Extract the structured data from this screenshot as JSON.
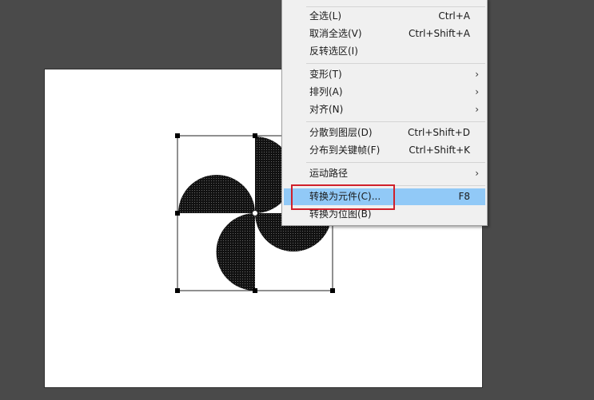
{
  "menu": {
    "items": [
      {
        "label": "全选(L)",
        "shortcut": "Ctrl+A"
      },
      {
        "label": "取消全选(V)",
        "shortcut": "Ctrl+Shift+A"
      },
      {
        "label": "反转选区(I)",
        "shortcut": ""
      },
      {
        "label": "变形(T)",
        "submenu": true
      },
      {
        "label": "排列(A)",
        "submenu": true
      },
      {
        "label": "对齐(N)",
        "submenu": true
      },
      {
        "label": "分散到图层(D)",
        "shortcut": "Ctrl+Shift+D"
      },
      {
        "label": "分布到关键帧(F)",
        "shortcut": "Ctrl+Shift+K"
      },
      {
        "label": "运动路径",
        "submenu": true
      },
      {
        "label": "转换为元件(C)...",
        "shortcut": "F8",
        "highlighted": true
      },
      {
        "label": "转换为位图(B)",
        "shortcut": ""
      }
    ]
  },
  "colors": {
    "workspace": "#4a4a4a",
    "stage": "#ffffff",
    "menu_highlight": "#91c9f7",
    "annotation_red": "#d0202a",
    "shape_fill": "#111111"
  },
  "icons": {
    "submenu": "chevron-right-icon"
  }
}
